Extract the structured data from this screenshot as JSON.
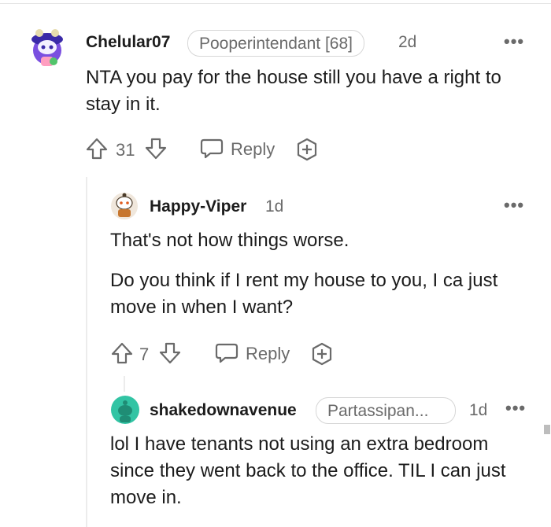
{
  "comments": [
    {
      "username": "Chelular07",
      "flair": "Pooperintendant [68]",
      "time": "2d",
      "more": "•••",
      "body": [
        "NTA you pay for the house still you have a right to stay in it."
      ],
      "votes": "31",
      "reply_label": "Reply"
    },
    {
      "username": "Happy-Viper",
      "time": "1d",
      "more": "•••",
      "body": [
        "That's not how things worse.",
        "Do you think if I rent my house to you, I ca just move in when I want?"
      ],
      "votes": "7",
      "reply_label": "Reply"
    },
    {
      "username": "shakedownavenue",
      "flair": "Partassipan...",
      "time": "1d",
      "more": "•••",
      "body": [
        "lol I have tenants not using an extra bedroom since they went back to the office. TIL I can just move in."
      ]
    }
  ],
  "colors": {
    "avatar2_bg": "#f0e7dc",
    "avatar3_bg": "#32c4a4",
    "text_muted": "#6a6a6a"
  }
}
